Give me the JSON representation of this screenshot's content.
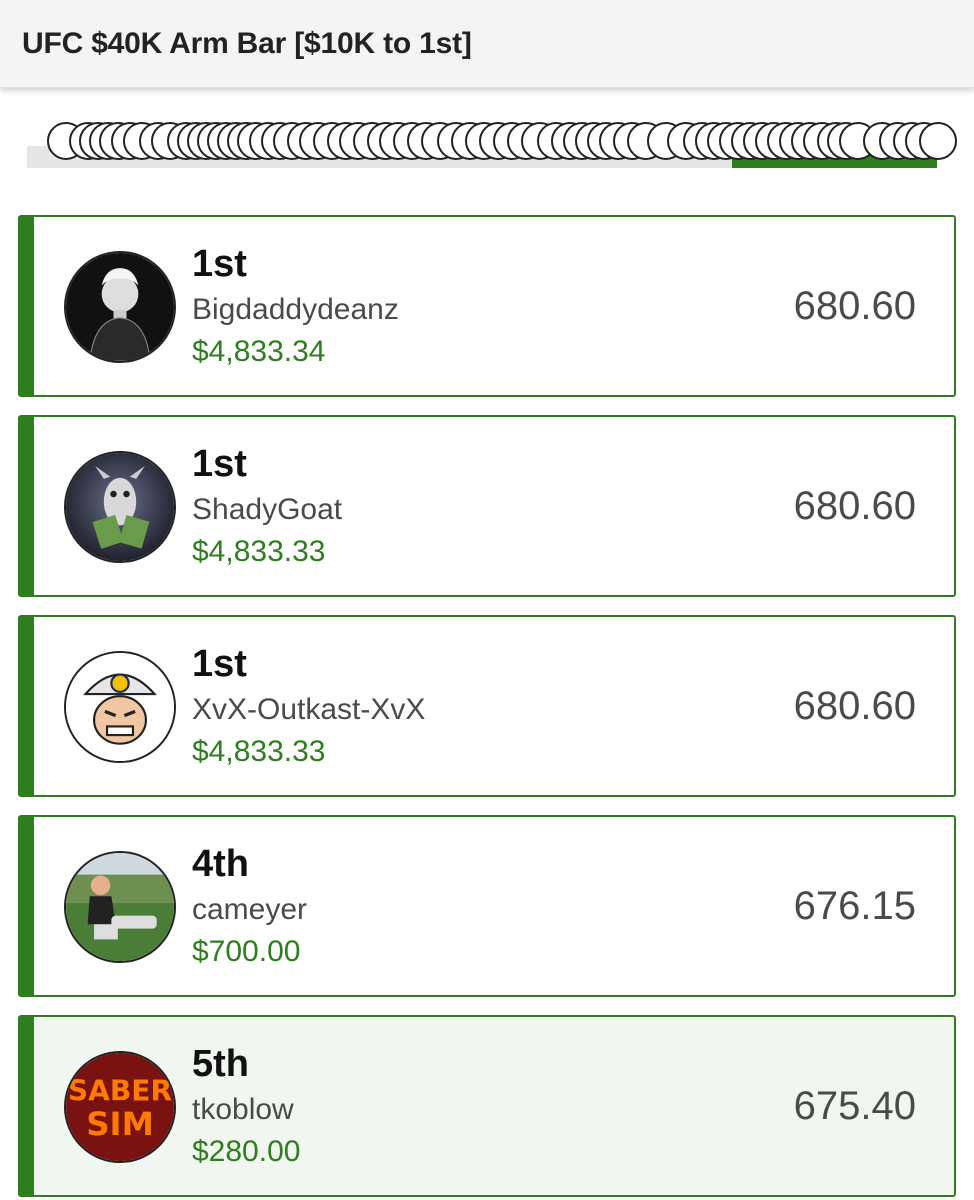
{
  "header": {
    "title": "UFC $40K Arm Bar [$10K to 1st]"
  },
  "entries": [
    {
      "rank": "1st",
      "username": "Bigdaddydeanz",
      "winnings": "$4,833.34",
      "score": "680.60",
      "avatar_icon": "sketch-portrait-avatar"
    },
    {
      "rank": "1st",
      "username": "ShadyGoat",
      "winnings": "$4,833.33",
      "score": "680.60",
      "avatar_icon": "goat-with-money-avatar"
    },
    {
      "rank": "1st",
      "username": "XvX-Outkast-XvX",
      "winnings": "$4,833.33",
      "score": "680.60",
      "avatar_icon": "dfsarmy-logo-avatar"
    },
    {
      "rank": "4th",
      "username": "cameyer",
      "winnings": "$700.00",
      "score": "676.15",
      "avatar_icon": "photo-avatar"
    },
    {
      "rank": "5th",
      "username": "tkoblow",
      "winnings": "$280.00",
      "score": "675.40",
      "avatar_icon": "sabersim-logo-avatar",
      "highlighted": true
    }
  ],
  "colors": {
    "accent": "#2e7d1f",
    "header_bg": "#f4f4f4",
    "text_muted": "#4a4a4a"
  }
}
